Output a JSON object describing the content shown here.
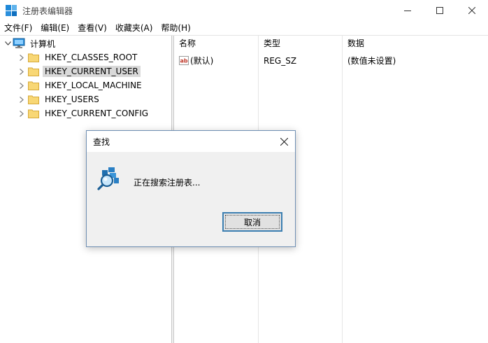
{
  "window": {
    "title": "注册表编辑器",
    "icon": "registry-editor-icon",
    "controls": [
      "minimize-icon",
      "maximize-icon",
      "close-icon"
    ]
  },
  "menu": [
    {
      "label": "文件(F)"
    },
    {
      "label": "编辑(E)"
    },
    {
      "label": "查看(V)"
    },
    {
      "label": "收藏夹(A)"
    },
    {
      "label": "帮助(H)"
    }
  ],
  "tree": {
    "root": {
      "label": "计算机",
      "icon": "computer-icon",
      "expanded": true
    },
    "children": [
      {
        "label": "HKEY_CLASSES_ROOT",
        "selected": false
      },
      {
        "label": "HKEY_CURRENT_USER",
        "selected": true
      },
      {
        "label": "HKEY_LOCAL_MACHINE",
        "selected": false
      },
      {
        "label": "HKEY_USERS",
        "selected": false
      },
      {
        "label": "HKEY_CURRENT_CONFIG",
        "selected": false
      }
    ]
  },
  "list": {
    "columns": [
      "名称",
      "类型",
      "数据"
    ],
    "rows": [
      {
        "name": "(默认)",
        "type": "REG_SZ",
        "data": "(数值未设置)",
        "icon": "string-value-icon"
      }
    ]
  },
  "dialog": {
    "title": "查找",
    "message": "正在搜索注册表...",
    "cancel_label": "取消",
    "icon": "registry-search-icon"
  },
  "colors": {
    "selection": "#d9d9d9",
    "dialog_border": "#6f8fb3",
    "button_focus": "#3c7fb1",
    "folder": "#f8d775"
  }
}
